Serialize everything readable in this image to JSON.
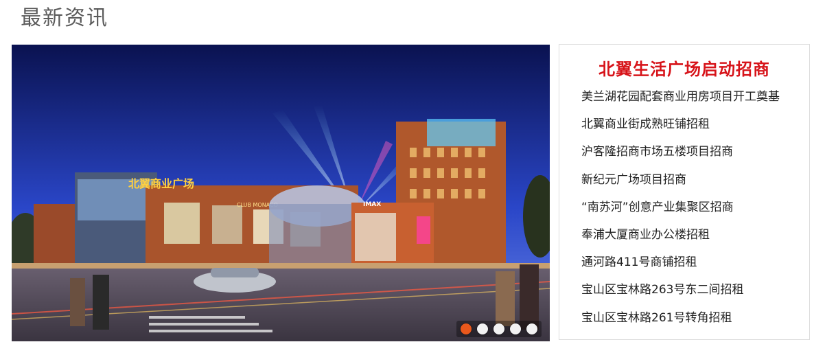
{
  "section": {
    "title": "最新资讯"
  },
  "slider": {
    "sign_main": "北翼商业广场",
    "sign_club": "CLUB MONACO",
    "sign_imax": "IMAX",
    "dots": [
      {
        "label": "1",
        "active": true
      },
      {
        "label": "2",
        "active": false
      },
      {
        "label": "3",
        "active": false
      },
      {
        "label": "4",
        "active": false
      },
      {
        "label": "5",
        "active": false
      }
    ]
  },
  "news": {
    "headline": "北翼生活广场启动招商",
    "items": [
      {
        "text": "美兰湖花园配套商业用房项目开工奠基"
      },
      {
        "text": "北翼商业街成熟旺铺招租"
      },
      {
        "text": "沪客隆招商市场五楼项目招商"
      },
      {
        "text": "新纪元广场项目招商"
      },
      {
        "text": "“南苏河”创意产业集聚区招商"
      },
      {
        "text": "奉浦大厦商业办公楼招租"
      },
      {
        "text": "通河路411号商铺招租"
      },
      {
        "text": "宝山区宝林路263号东二间招租"
      },
      {
        "text": "宝山区宝林路261号转角招租"
      }
    ]
  },
  "colors": {
    "headline": "#d7141a",
    "active_dot": "#e9581c"
  }
}
